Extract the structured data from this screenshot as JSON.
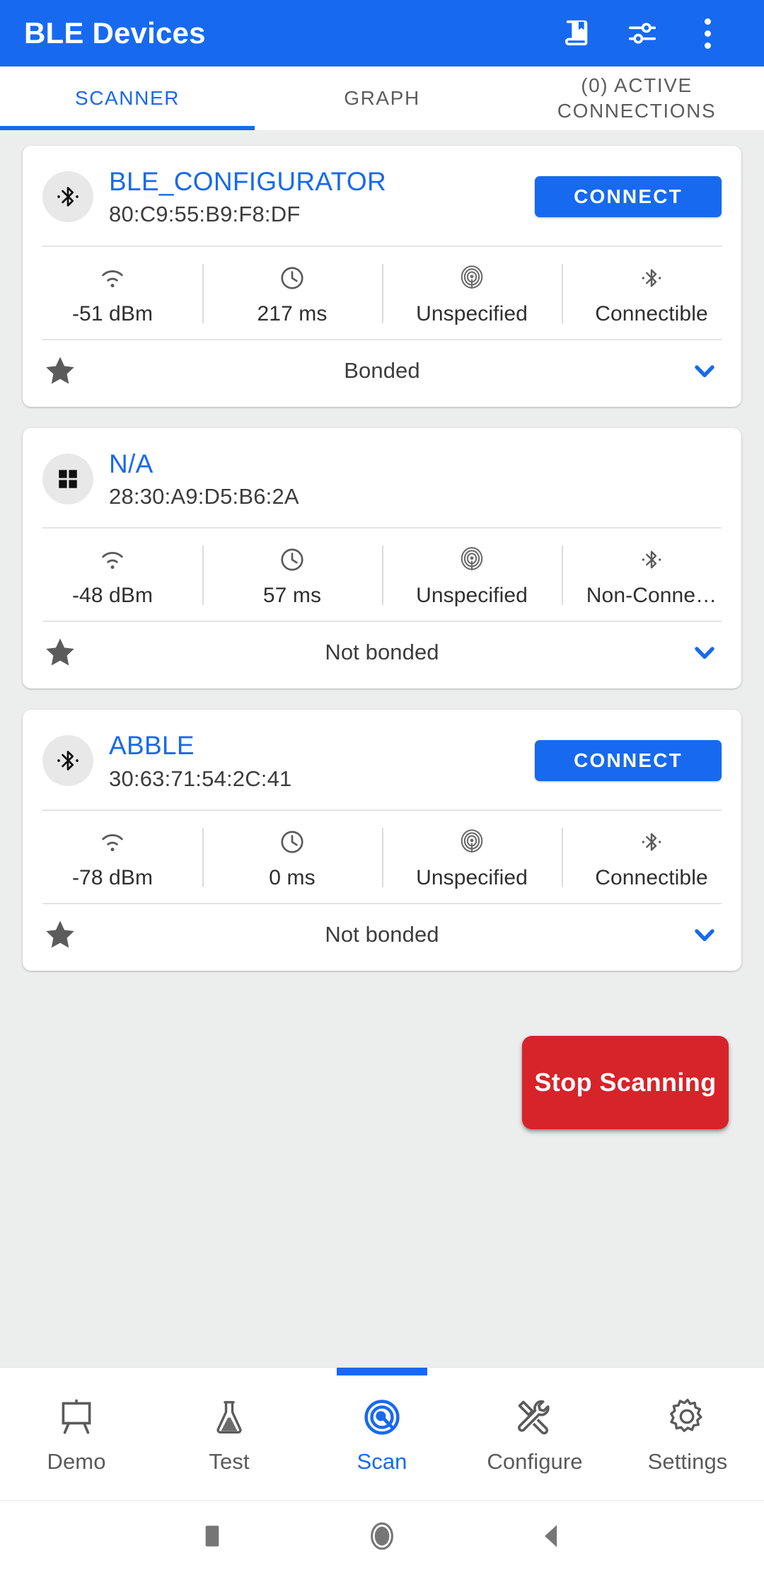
{
  "appbar": {
    "title": "BLE Devices",
    "actions": [
      {
        "name": "bookmarks-icon",
        "label": "Bookmarks"
      },
      {
        "name": "filter-settings-icon",
        "label": "Filter"
      },
      {
        "name": "overflow-menu-icon",
        "label": "More options"
      }
    ]
  },
  "tabs": [
    {
      "label": "SCANNER",
      "active": true
    },
    {
      "label": "GRAPH",
      "active": false
    },
    {
      "label": "(0) ACTIVE CONNECTIONS",
      "active": false
    }
  ],
  "devices": [
    {
      "name": "BLE_CONFIGURATOR",
      "mac": "80:C9:55:B9:F8:DF",
      "avatar_icon": "bluetooth-icon",
      "connect_label": "CONNECT",
      "has_connect": true,
      "rssi": "-51 dBm",
      "interval": "217 ms",
      "appearance": "Unspecified",
      "connectable": "Connectible",
      "bond_state": "Bonded",
      "favorite": true,
      "expanded": false
    },
    {
      "name": "N/A",
      "mac": "28:30:A9:D5:B6:2A",
      "avatar_icon": "grid-squares-icon",
      "connect_label": "",
      "has_connect": false,
      "rssi": "-48 dBm",
      "interval": "57 ms",
      "appearance": "Unspecified",
      "connectable": "Non-Conne…",
      "bond_state": "Not bonded",
      "favorite": true,
      "expanded": false
    },
    {
      "name": "ABBLE",
      "mac": "30:63:71:54:2C:41",
      "avatar_icon": "bluetooth-icon",
      "connect_label": "CONNECT",
      "has_connect": true,
      "rssi": "-78 dBm",
      "interval": "0 ms",
      "appearance": "Unspecified",
      "connectable": "Connectible",
      "bond_state": "Not bonded",
      "favorite": true,
      "expanded": false
    }
  ],
  "scan_button": {
    "label": "Stop Scanning"
  },
  "bottom_nav": [
    {
      "label": "Demo",
      "icon": "easel-presentation-icon",
      "active": false
    },
    {
      "label": "Test",
      "icon": "flask-icon",
      "active": false
    },
    {
      "label": "Scan",
      "icon": "target-scan-icon",
      "active": true
    },
    {
      "label": "Configure",
      "icon": "wrench-screwdriver-icon",
      "active": false
    },
    {
      "label": "Settings",
      "icon": "gear-icon",
      "active": false
    }
  ],
  "system_nav": [
    {
      "name": "recent-apps-button"
    },
    {
      "name": "home-button"
    },
    {
      "name": "back-button"
    }
  ],
  "colors": {
    "primary": "#1769f0",
    "danger": "#d7232a",
    "background": "#eceded",
    "card": "#ffffff",
    "muted_text": "#5a5a5a"
  }
}
